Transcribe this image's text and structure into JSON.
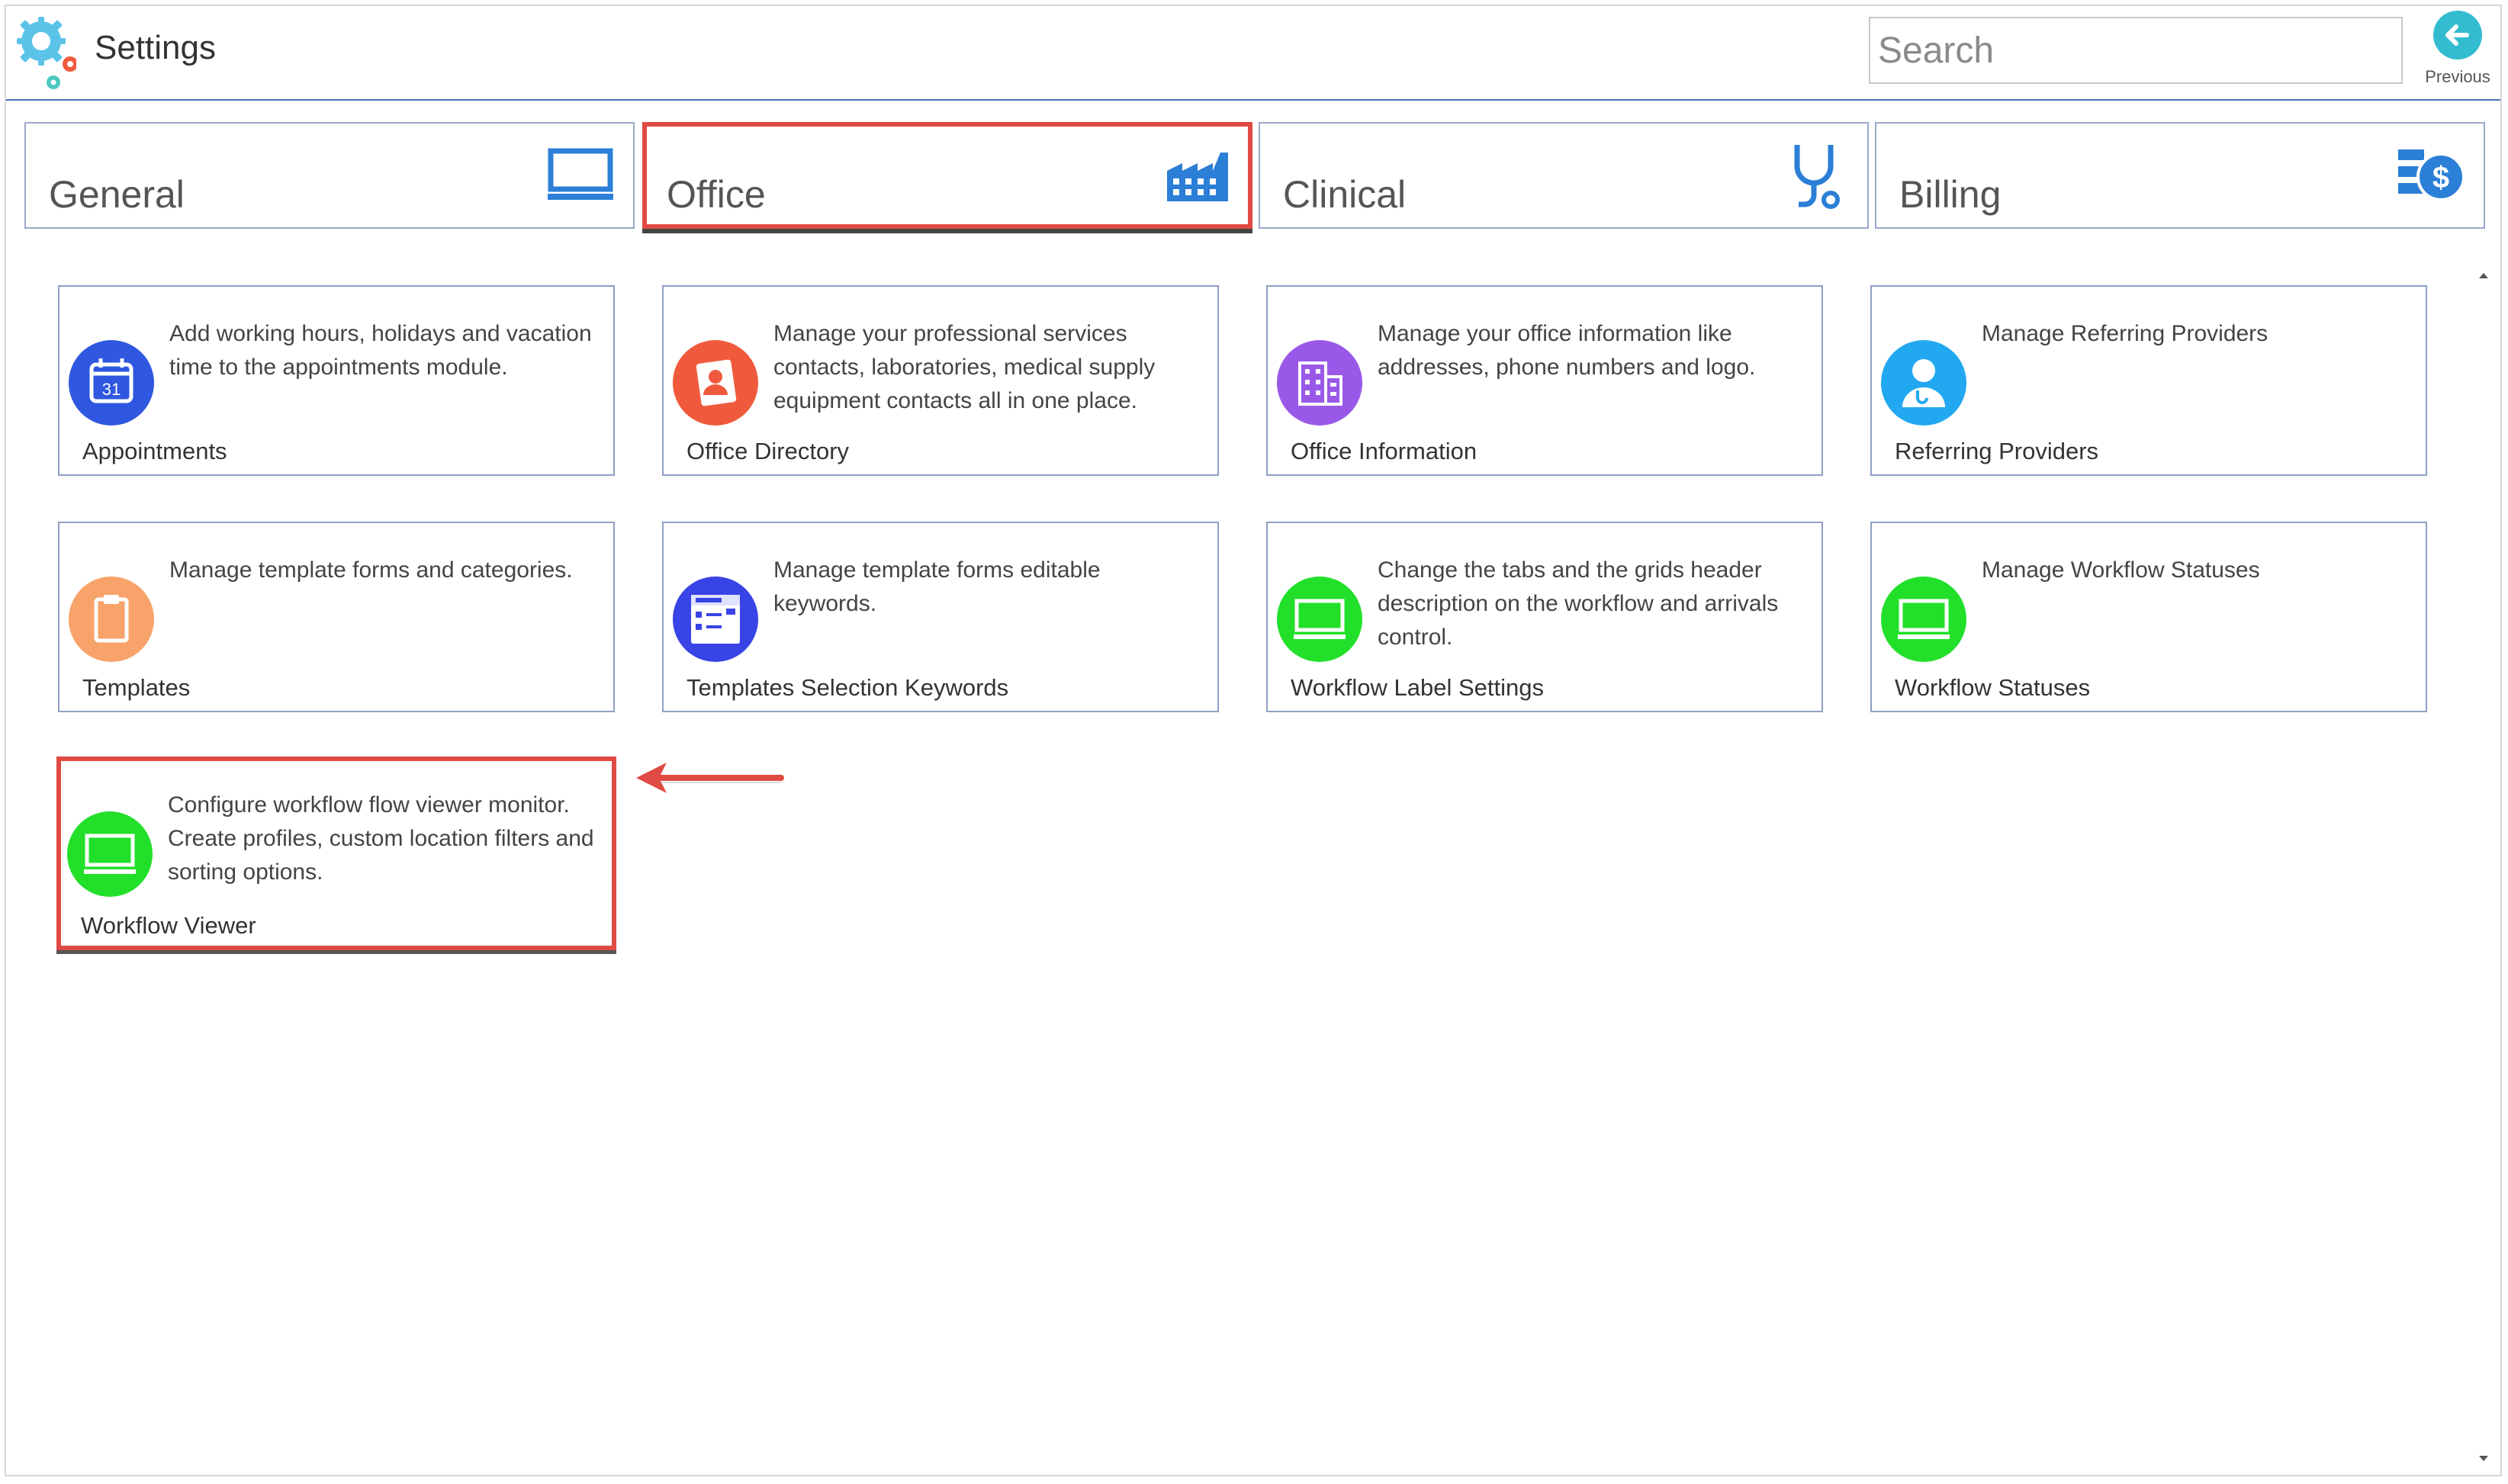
{
  "header": {
    "title": "Settings",
    "search_placeholder": "Search",
    "previous_label": "Previous"
  },
  "tabs": [
    {
      "label": "General",
      "icon": "monitor-icon",
      "active": false
    },
    {
      "label": "Office",
      "icon": "factory-icon",
      "active": true
    },
    {
      "label": "Clinical",
      "icon": "stethoscope-icon",
      "active": false
    },
    {
      "label": "Billing",
      "icon": "billing-dollar-icon",
      "active": false
    }
  ],
  "cards": [
    {
      "title": "Appointments",
      "description": "Add working hours, holidays and vacation time to the appointments module.",
      "icon": "calendar-icon",
      "icon_color": "#2f57e0",
      "icon_text": "31"
    },
    {
      "title": "Office Directory",
      "description": "Manage your professional services contacts, laboratories, medical supply equipment contacts all in one place.",
      "icon": "contact-card-icon",
      "icon_color": "#f05a3c"
    },
    {
      "title": "Office Information",
      "description": "Manage your office information like addresses, phone numbers and logo.",
      "icon": "building-icon",
      "icon_color": "#9a58e8"
    },
    {
      "title": "Referring Providers",
      "description": "Manage Referring Providers",
      "icon": "doctor-icon",
      "icon_color": "#22a8f0"
    },
    {
      "title": "Templates",
      "description": "Manage template forms and categories.",
      "icon": "clipboard-icon",
      "icon_color": "#f7a36a"
    },
    {
      "title": "Templates Selection Keywords",
      "description": "Manage template forms editable keywords.",
      "icon": "form-keywords-icon",
      "icon_color": "#3844e6"
    },
    {
      "title": "Workflow Label Settings",
      "description": "Change the tabs and the grids header description on the workflow and arrivals control.",
      "icon": "monitor-icon",
      "icon_color": "#22e02a"
    },
    {
      "title": "Workflow Statuses",
      "description": "Manage Workflow Statuses",
      "icon": "monitor-icon",
      "icon_color": "#22e02a"
    },
    {
      "title": "Workflow Viewer",
      "description": "Configure workflow flow viewer monitor. Create profiles, custom location filters and sorting options.",
      "icon": "monitor-icon",
      "icon_color": "#22e02a",
      "highlighted": true
    }
  ],
  "colors": {
    "accent_blue": "#2b7fd6",
    "highlight_red": "#e04a44",
    "previous_teal": "#33bcd0"
  }
}
